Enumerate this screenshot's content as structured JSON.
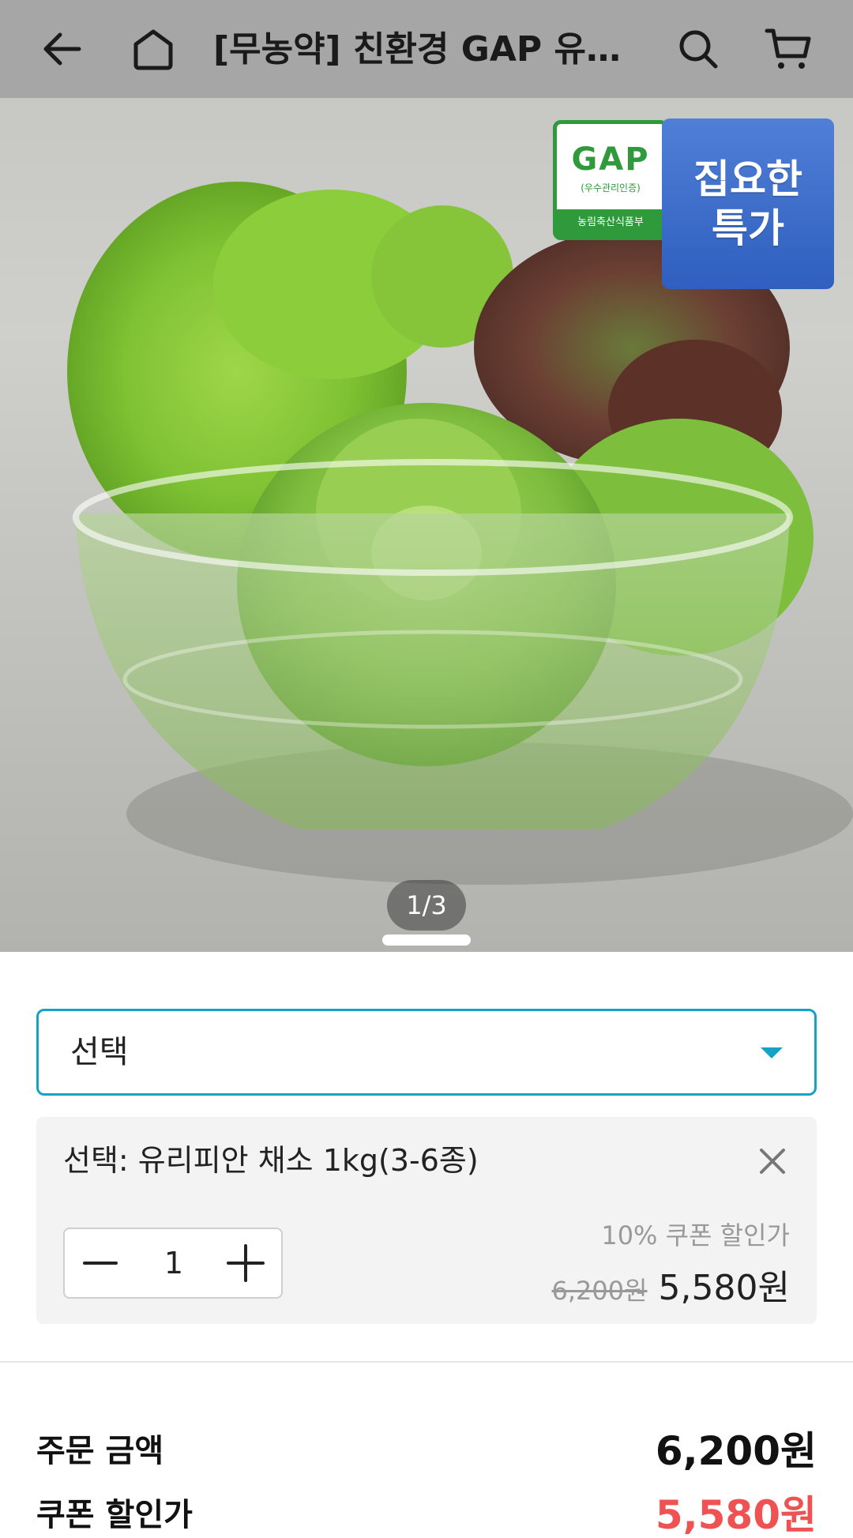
{
  "header": {
    "title": "[무농약] 친환경 GAP 유러…",
    "icons": [
      "back-arrow-icon",
      "home-icon",
      "search-icon",
      "cart-icon"
    ]
  },
  "hero": {
    "badges": {
      "gap_title": "GAP",
      "gap_sub": "(우수관리인증)",
      "gap_foot": "농림축산식품부",
      "deal_line1": "집요한",
      "deal_line2": "특가"
    },
    "page_indicator": "1/3"
  },
  "option": {
    "select_label": "선택",
    "selected_name": "선택: 유리피안 채소 1kg(3-6종)",
    "quantity": "1",
    "coupon_label": "10% 쿠폰 할인가",
    "original_price": "6,200원",
    "sale_price": "5,580원"
  },
  "summary": {
    "order_amount_label": "주문 금액",
    "order_amount_value": "6,200원",
    "coupon_price_label": "쿠폰 할인가",
    "coupon_price_value": "5,580원"
  },
  "colors": {
    "accent": "#14a3c7",
    "discount_red": "#ef5252",
    "gap_green": "#2f9a3c",
    "deal_blue": "#2f5fbf"
  }
}
